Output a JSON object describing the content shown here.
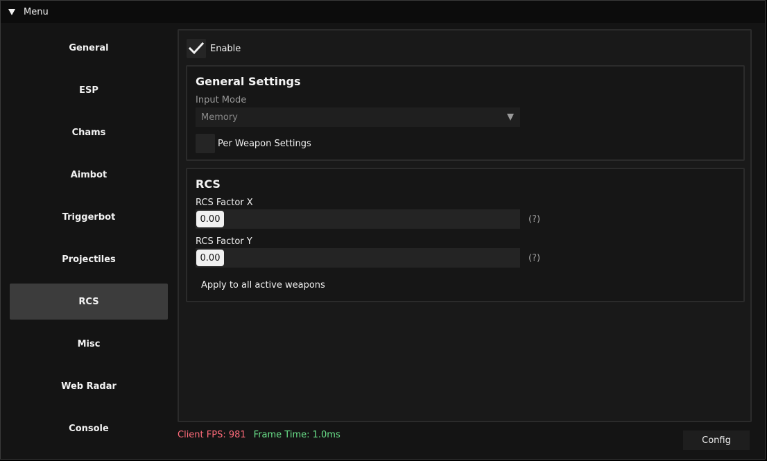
{
  "window": {
    "title": "Menu"
  },
  "sidebar": {
    "items": [
      {
        "label": "General"
      },
      {
        "label": "ESP"
      },
      {
        "label": "Chams"
      },
      {
        "label": "Aimbot"
      },
      {
        "label": "Triggerbot"
      },
      {
        "label": "Projectiles"
      },
      {
        "label": "RCS",
        "active": true
      },
      {
        "label": "Misc"
      },
      {
        "label": "Web Radar"
      },
      {
        "label": "Console"
      }
    ]
  },
  "main": {
    "enable": {
      "label": "Enable",
      "checked": true
    },
    "general_settings": {
      "title": "General Settings",
      "input_mode": {
        "label": "Input Mode",
        "value": "Memory"
      },
      "per_weapon": {
        "label": "Per Weapon Settings",
        "checked": false
      }
    },
    "rcs": {
      "title": "RCS",
      "factor_x": {
        "label": "RCS Factor X",
        "value": "0.00",
        "help": "(?)"
      },
      "factor_y": {
        "label": "RCS Factor Y",
        "value": "0.00",
        "help": "(?)"
      },
      "apply_button": "Apply to all active weapons"
    }
  },
  "footer": {
    "fps": "Client FPS: 981",
    "frame_time": "Frame Time: 1.0ms",
    "config_button": "Config"
  },
  "colors": {
    "fps": "#ff6b7a",
    "frame_time": "#6be38b",
    "active_tab": "#3c3c3c"
  }
}
